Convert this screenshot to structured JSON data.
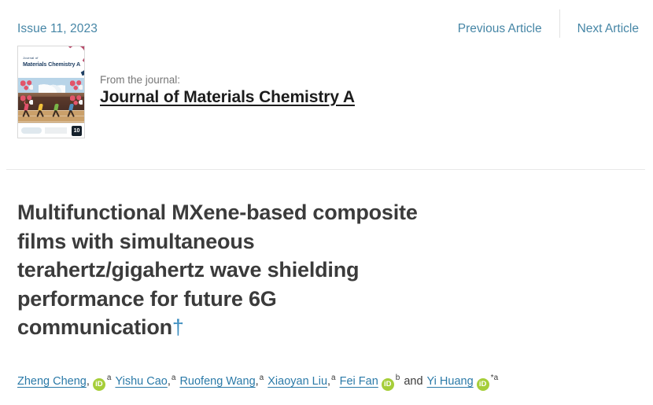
{
  "header": {
    "issue_label": "Issue 11, 2023",
    "previous_article": "Previous Article",
    "next_article": "Next Article",
    "link_color": "#4686a6"
  },
  "journal": {
    "from_label": "From the journal:",
    "name": "Journal of Materials Chemistry A",
    "cover": {
      "title_line1": "Journal of",
      "title_line2": "Materials Chemistry A",
      "badge": "10"
    }
  },
  "article": {
    "title": "Multifunctional MXene-based composite films with simultaneous terahertz/gigahertz wave shielding performance for future 6G communication",
    "footnote_marker": "†",
    "title_color": "#3b3b3b",
    "footnote_color": "#3f8fc0"
  },
  "authors": {
    "orcid_label": "iD",
    "orcid_color": "#a6ce39",
    "conjunction": "and",
    "list": [
      {
        "name": "Zheng Cheng",
        "separator": ",",
        "orcid": true,
        "affiliation": "a"
      },
      {
        "name": "Yishu Cao",
        "separator": ",",
        "orcid": false,
        "affiliation": "a"
      },
      {
        "name": "Ruofeng Wang",
        "separator": ",",
        "orcid": false,
        "affiliation": "a"
      },
      {
        "name": "Xiaoyan Liu",
        "separator": ",",
        "orcid": false,
        "affiliation": "a"
      },
      {
        "name": "Fei Fan",
        "separator": "",
        "orcid": true,
        "affiliation": "b"
      },
      {
        "name": "Yi Huang",
        "separator": "",
        "orcid": true,
        "affiliation": "*a"
      }
    ]
  }
}
